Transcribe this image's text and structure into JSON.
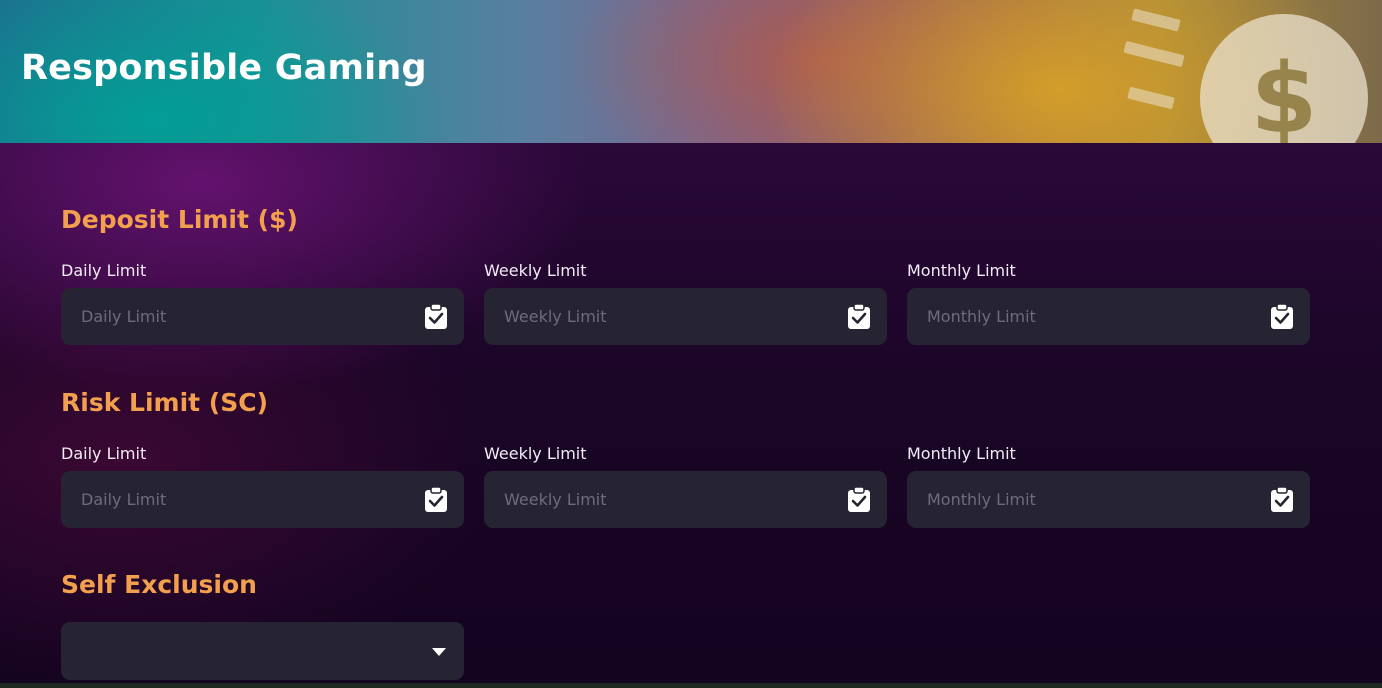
{
  "header": {
    "title": "Responsible Gaming",
    "art_icon": "coin-dollar-icon"
  },
  "sections": {
    "deposit": {
      "title": "Deposit Limit ($)",
      "fields": [
        {
          "label": "Daily Limit",
          "placeholder": "Daily Limit",
          "value": ""
        },
        {
          "label": "Weekly Limit",
          "placeholder": "Weekly Limit",
          "value": ""
        },
        {
          "label": "Monthly Limit",
          "placeholder": "Monthly Limit",
          "value": ""
        }
      ]
    },
    "risk": {
      "title": "Risk Limit (SC)",
      "fields": [
        {
          "label": "Daily Limit",
          "placeholder": "Daily Limit",
          "value": ""
        },
        {
          "label": "Weekly Limit",
          "placeholder": "Weekly Limit",
          "value": ""
        },
        {
          "label": "Monthly Limit",
          "placeholder": "Monthly Limit",
          "value": ""
        }
      ]
    },
    "self_exclusion": {
      "title": "Self Exclusion",
      "selected": ""
    }
  },
  "icons": {
    "field_action": "clipboard-check-icon",
    "dropdown": "caret-down-icon"
  },
  "colors": {
    "accent": "#f3a04e",
    "field_bg": "#262433",
    "label_text": "#f1ecf5",
    "placeholder_text": "#6e6b7a"
  }
}
